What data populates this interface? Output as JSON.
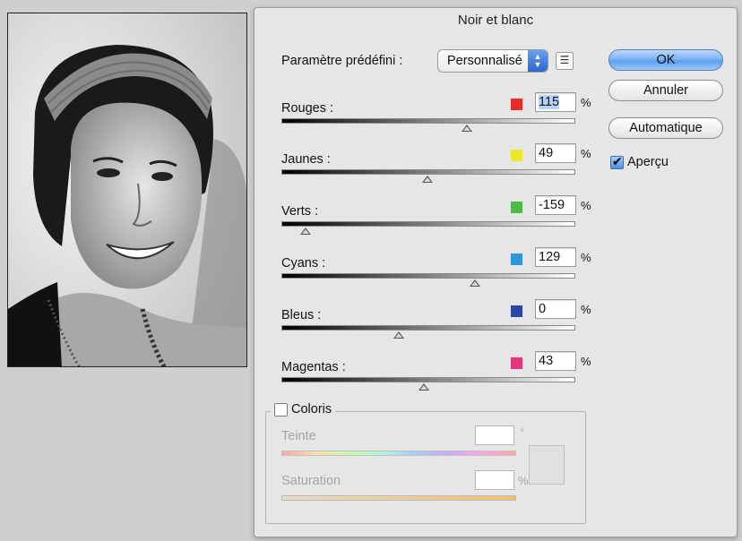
{
  "dialog": {
    "title": "Noir et blanc"
  },
  "preset": {
    "label": "Paramètre prédéfini :",
    "value": "Personnalisé"
  },
  "buttons": {
    "ok": "OK",
    "cancel": "Annuler",
    "auto": "Automatique"
  },
  "preview": {
    "label": "Aperçu",
    "checked": true
  },
  "channels": [
    {
      "label": "Rouges :",
      "value": "115",
      "unit": "%",
      "color": "#e62b2b",
      "slider_value": 115
    },
    {
      "label": "Jaunes :",
      "value": "49",
      "unit": "%",
      "color": "#ece82a",
      "slider_value": 49
    },
    {
      "label": "Verts :",
      "value": "-159",
      "unit": "%",
      "color": "#4dbb47",
      "slider_value": -159
    },
    {
      "label": "Cyans :",
      "value": "129",
      "unit": "%",
      "color": "#2f96d8",
      "slider_value": 129
    },
    {
      "label": "Bleus :",
      "value": "0",
      "unit": "%",
      "color": "#2b48a6",
      "slider_value": 0
    },
    {
      "label": "Magentas :",
      "value": "43",
      "unit": "%",
      "color": "#e6357f",
      "slider_value": 43
    }
  ],
  "slider_range": [
    -200,
    300
  ],
  "coloris": {
    "label": "Coloris",
    "checked": false,
    "hue_label": "Teinte",
    "hue_unit": "°",
    "saturation_label": "Saturation",
    "saturation_unit": "%"
  }
}
